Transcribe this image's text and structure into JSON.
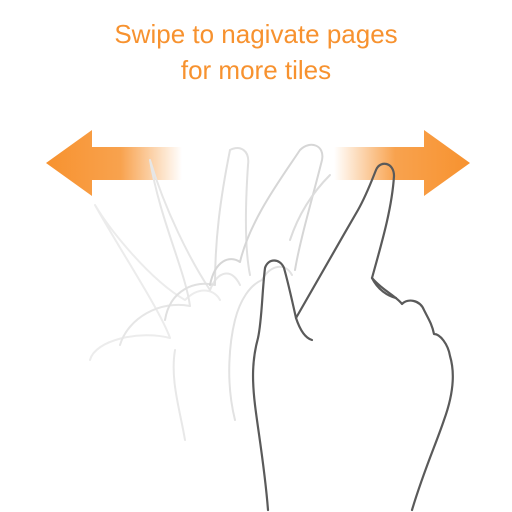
{
  "hint": {
    "line1": "Swipe to nagivate pages",
    "line2": "for more tiles"
  },
  "colors": {
    "accent": "#F7922F",
    "hand_stroke": "#5a5a5a",
    "ghost_stroke": "#c8c8c8"
  },
  "icons": {
    "left_arrow": "arrow-left-icon",
    "right_arrow": "arrow-right-icon",
    "hand": "swipe-hand-icon"
  }
}
